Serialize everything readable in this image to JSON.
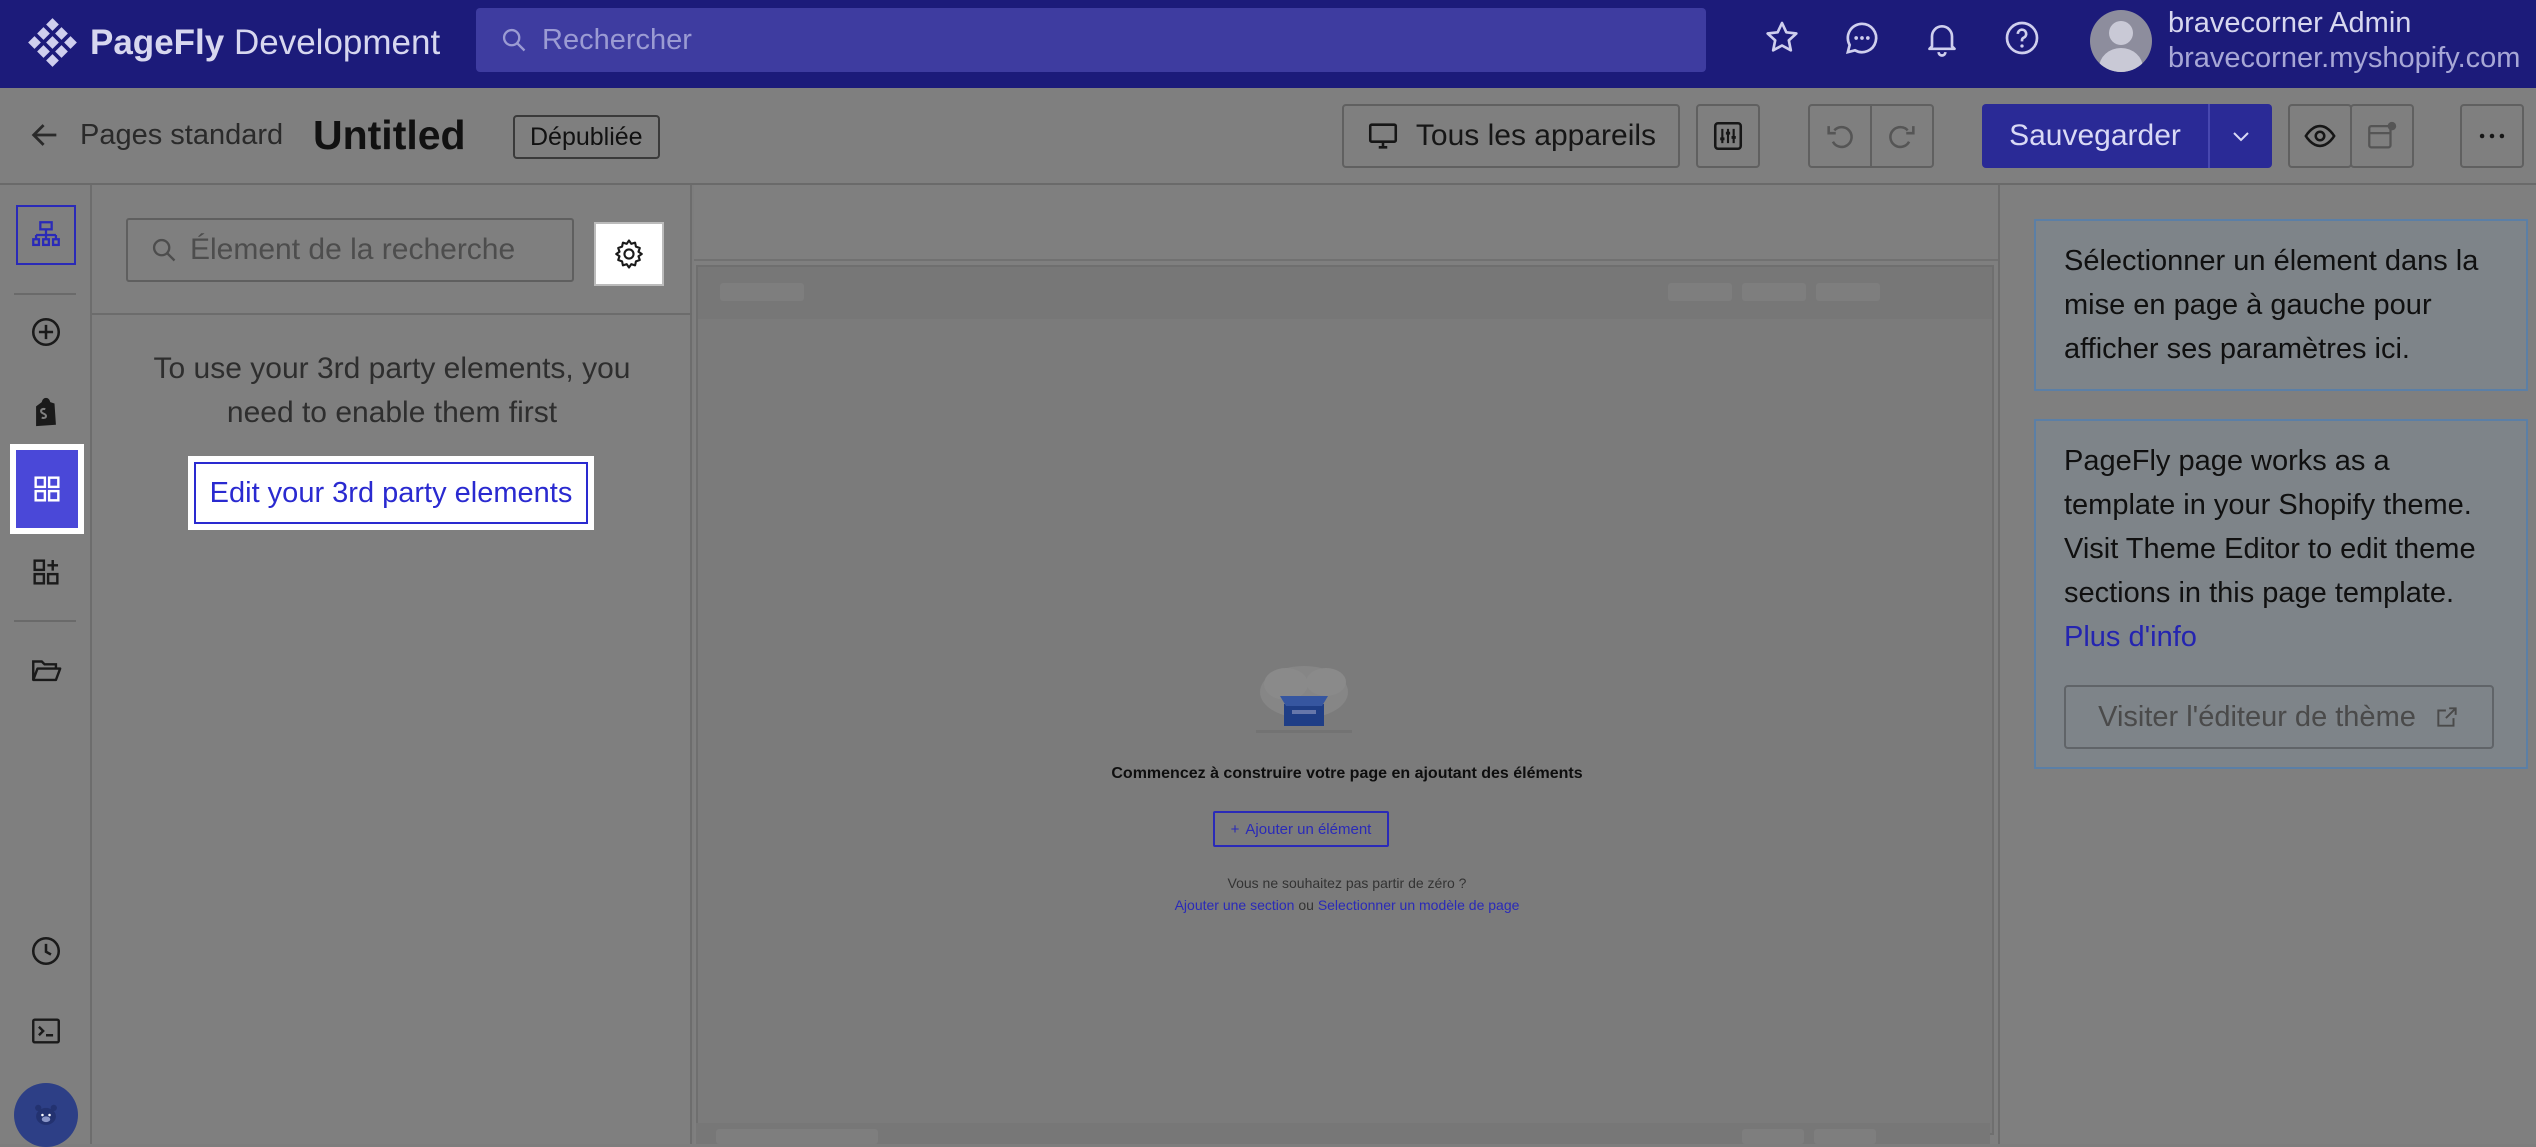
{
  "topbar": {
    "logo_brand": "PageFly",
    "logo_env": "Development",
    "search_placeholder": "Rechercher",
    "icons": [
      "star-icon",
      "chat-icon",
      "bell-icon",
      "help-icon"
    ],
    "user_name": "bravecorner Admin",
    "user_store": "bravecorner.myshopify.com"
  },
  "toolbar": {
    "back_label": "Pages standard",
    "page_title": "Untitled",
    "status": "Dépubliée",
    "device_label": "Tous les appareils",
    "save_label": "Sauvegarder"
  },
  "rail": {
    "items": [
      "layers-icon",
      "add-circle-icon",
      "shopify-bag-icon",
      "grid-elements-icon",
      "apps-add-icon",
      "folder-icon",
      "history-icon",
      "terminal-icon",
      "mascot-avatar"
    ],
    "active": "grid-elements-icon"
  },
  "elements_panel": {
    "search_placeholder": "Élement de la recherche",
    "message": "To use your 3rd party elements, you need to enable them first",
    "edit_link": "Edit your 3rd party elements"
  },
  "canvas": {
    "empty_title": "Commencez à construire votre page en ajoutant des éléments",
    "add_button": "Ajouter un élément",
    "question": "Vous ne souhaitez pas partir de zéro ?",
    "link_section": "Ajouter une section",
    "link_or": "ou",
    "link_template": "Selectionner un modèle de page"
  },
  "right_panel": {
    "hint": "Sélectionner un élement dans la mise en page à gauche pour afficher ses paramètres ici.",
    "template_info": "PageFly page works as a template in your Shopify theme. Visit Theme Editor to edit theme sections in this page template.",
    "more_info": "Plus d'info",
    "theme_button": "Visiter l'éditeur de thème"
  },
  "colors": {
    "topbar": "#1c1b7a",
    "accent": "#2a2a96",
    "link": "#2a2ad0"
  }
}
